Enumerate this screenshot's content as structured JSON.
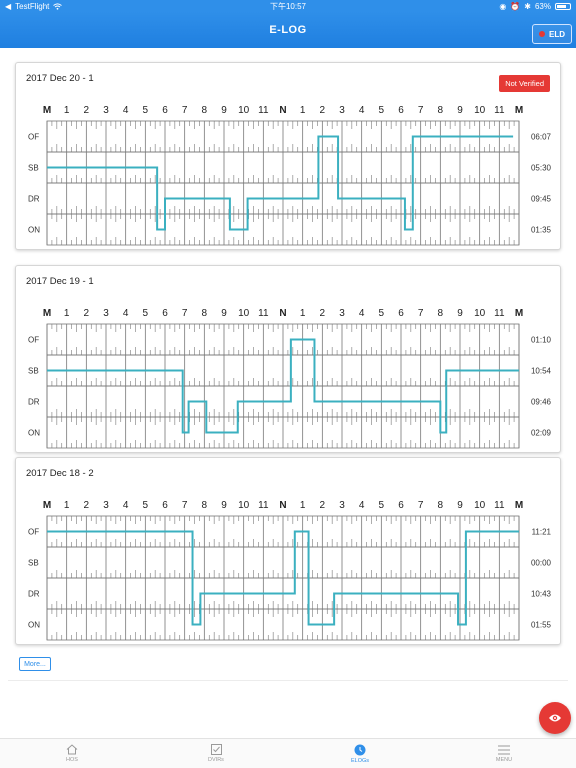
{
  "status_bar": {
    "carrier": "TestFlight",
    "time": "下午10:57",
    "battery": "63%",
    "battery_level": 0.63
  },
  "app_bar": {
    "title": "E-LOG",
    "eld_label": "ELD"
  },
  "colors": {
    "primary": "#2f8fe9",
    "trace": "#3bb0c0",
    "danger": "#e53935",
    "grid": "#777777"
  },
  "hour_labels": [
    "M",
    "1",
    "2",
    "3",
    "4",
    "5",
    "6",
    "7",
    "8",
    "9",
    "10",
    "11",
    "N",
    "1",
    "2",
    "3",
    "4",
    "5",
    "6",
    "7",
    "8",
    "9",
    "10",
    "11",
    "M"
  ],
  "statuses": [
    "OF",
    "SB",
    "DR",
    "ON"
  ],
  "logs": [
    {
      "title": "2017 Dec 20 - 1",
      "badge": "Not Verified",
      "totals": [
        "06:07",
        "05:30",
        "09:45",
        "01:35"
      ],
      "segments": [
        [
          0,
          5.6,
          1
        ],
        [
          5.6,
          6.0,
          3
        ],
        [
          6.0,
          9.3,
          2
        ],
        [
          9.3,
          10.2,
          3
        ],
        [
          10.2,
          13.8,
          2
        ],
        [
          13.8,
          14.8,
          0
        ],
        [
          14.8,
          18.2,
          2
        ],
        [
          18.2,
          18.6,
          3
        ],
        [
          18.6,
          23.7,
          0
        ]
      ]
    },
    {
      "title": "2017 Dec 19 - 1",
      "badge": "",
      "totals": [
        "01:10",
        "10:54",
        "09:46",
        "02:09"
      ],
      "segments": [
        [
          0,
          6.9,
          1
        ],
        [
          6.9,
          7.2,
          3
        ],
        [
          7.2,
          8.1,
          2
        ],
        [
          8.1,
          9.7,
          3
        ],
        [
          9.7,
          12.4,
          2
        ],
        [
          12.4,
          13.6,
          0
        ],
        [
          13.6,
          20.0,
          2
        ],
        [
          20.0,
          20.3,
          3
        ],
        [
          20.3,
          24.0,
          1
        ]
      ]
    },
    {
      "title": "2017 Dec 18 - 2",
      "badge": "",
      "totals": [
        "11:21",
        "00:00",
        "10:43",
        "01:55"
      ],
      "segments": [
        [
          0,
          7.4,
          0
        ],
        [
          7.4,
          7.8,
          3
        ],
        [
          7.8,
          12.6,
          2
        ],
        [
          12.6,
          13.3,
          0
        ],
        [
          13.3,
          14.6,
          3
        ],
        [
          14.6,
          20.9,
          2
        ],
        [
          20.9,
          21.3,
          3
        ],
        [
          21.3,
          24.0,
          0
        ]
      ]
    }
  ],
  "more_label": "More...",
  "tabs": [
    {
      "label": "HOS",
      "icon": "home-icon"
    },
    {
      "label": "DVIRs",
      "icon": "checkbox-icon"
    },
    {
      "label": "ELOGs",
      "icon": "clock-icon"
    },
    {
      "label": "MENU",
      "icon": "menu-icon"
    }
  ],
  "active_tab": 2
}
